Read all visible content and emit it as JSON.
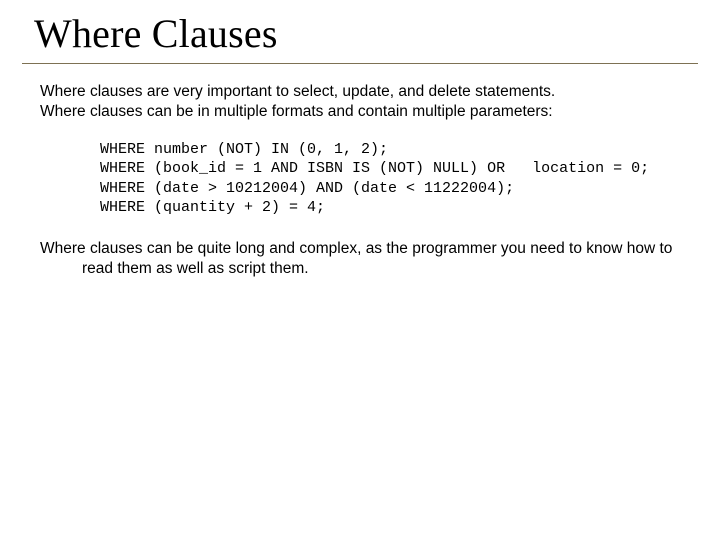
{
  "title": "Where Clauses",
  "intro_line1": "Where clauses are very important to select, update, and delete statements.",
  "intro_line2": "Where clauses can be in multiple formats and contain multiple parameters:",
  "code": {
    "l1": "WHERE number (NOT) IN (0, 1, 2);",
    "l2": "WHERE (book_id = 1 AND ISBN IS (NOT) NULL) OR   location = 0;",
    "l3": "WHERE (date > 10212004) AND (date < 11222004);",
    "l4": "WHERE (quantity + 2) = 4;"
  },
  "closing": "Where clauses can be quite long and complex, as the programmer you need to know how to read them as well as script them."
}
